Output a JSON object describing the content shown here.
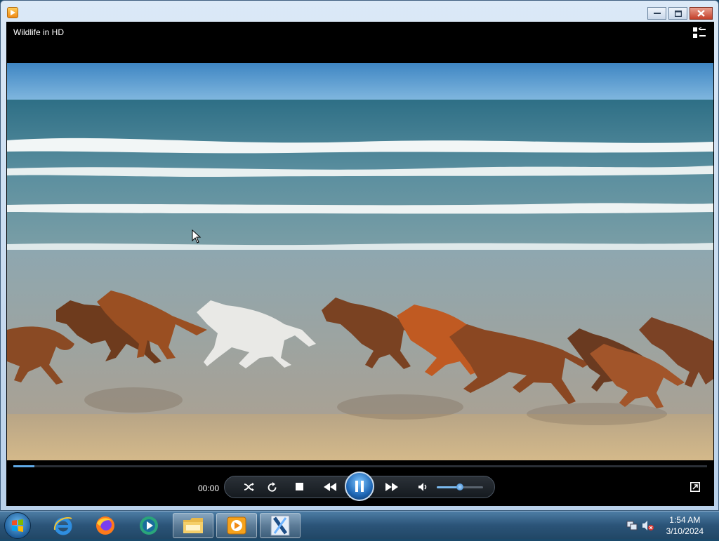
{
  "window": {
    "title": "Wildlife in HD"
  },
  "player": {
    "elapsed": "00:00",
    "seek_progress_fraction": 0.03,
    "volume_fraction": 0.5
  },
  "taskbar": {
    "clock_time": "1:54 AM",
    "clock_date": "3/10/2024",
    "pinned": [
      "internet-explorer-icon",
      "firefox-icon",
      "media-center-icon",
      "file-explorer-icon",
      "media-player-icon",
      "video-editor-icon"
    ]
  },
  "colors": {
    "accent": "#1e66b5",
    "seek": "#5fa9e6",
    "taskbar": "#2b5478"
  }
}
